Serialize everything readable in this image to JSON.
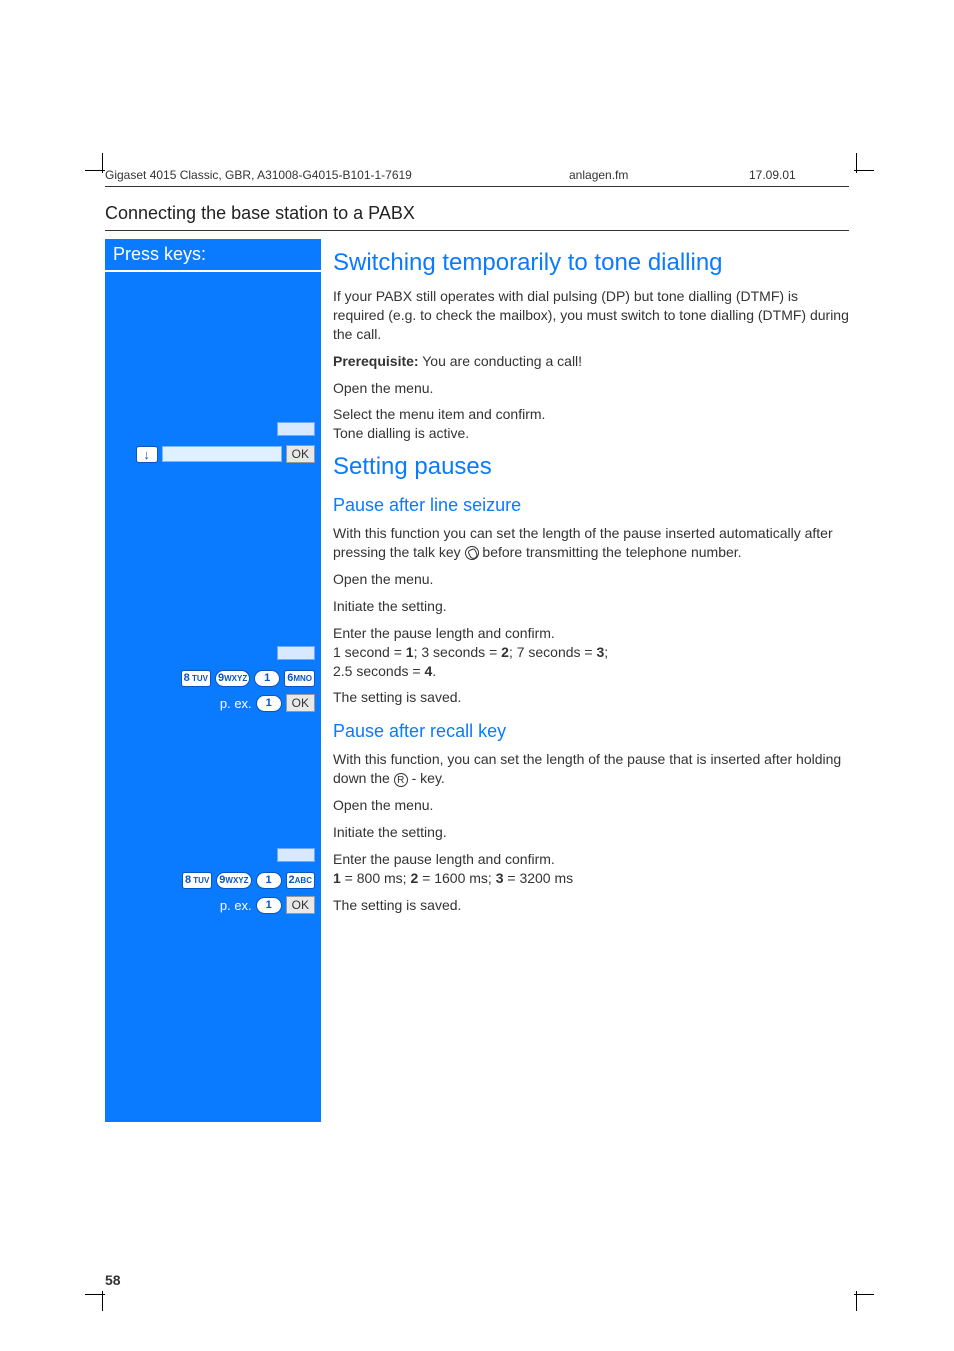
{
  "meta": {
    "doc_id": "Gigaset 4015 Classic, GBR, A31008-G4015-B101-1-7619",
    "file": "anlagen.fm",
    "date": "17.09.01"
  },
  "section_title": "Connecting the base station to a PABX",
  "left": {
    "press_keys": "Press keys:",
    "ok": "OK",
    "dtmf_menu_hint": "",
    "arrow": "↓",
    "seq1_keys": [
      "8 TUV",
      "9 WXYZ",
      "1",
      "6 MNO"
    ],
    "seq2_keys": [
      "8 TUV",
      "9 WXYZ",
      "1",
      "2 ABC"
    ],
    "example_prefix": "p. ex.",
    "example_key": "1"
  },
  "content": {
    "h1": "Switching temporarily to tone dialling",
    "p1": "If your PABX still operates with dial pulsing (DP) but tone dialling (DTMF) is required (e.g. to check the mailbox), you must switch to tone dialling (DTMF) during the call.",
    "prereq_label": "Prerequisite:",
    "prereq_text": " You are conducting a call!",
    "open_menu": "Open the menu.",
    "select_confirm": "Select the menu item and confirm.",
    "tone_active": "Tone dialling is active.",
    "h2": "Setting pauses",
    "h3a": "Pause after line seizure",
    "p2a": "With this function you can set the length of the pause inserted automatically after pressing the talk key ",
    "p2b": " before transmitting the telephone number.",
    "initiate": "Initiate the setting.",
    "enter_confirm": "Enter the pause length and confirm.",
    "pause1_values_a": "1 second = ",
    "pause1_values_b": "; 3 seconds = ",
    "pause1_values_c": "; 7 seconds = ",
    "pause1_values_d": ";",
    "pause1_values_e": "2.5 seconds = ",
    "pause1_values_f": ".",
    "v1": "1",
    "v2": "2",
    "v3": "3",
    "v4": "4",
    "saved": "The setting is saved.",
    "h3b": "Pause after recall key",
    "p3a": "With this function, you can set the length of the pause that is inserted after holding down the ",
    "p3b": " - key.",
    "r_label": "R",
    "pause2_values_a": " = 800 ms; ",
    "pause2_values_b": " = 1600 ms; ",
    "pause2_values_c": " = 3200 ms",
    "w1": "1",
    "w2": "2",
    "w3": "3"
  },
  "page_number": "58"
}
